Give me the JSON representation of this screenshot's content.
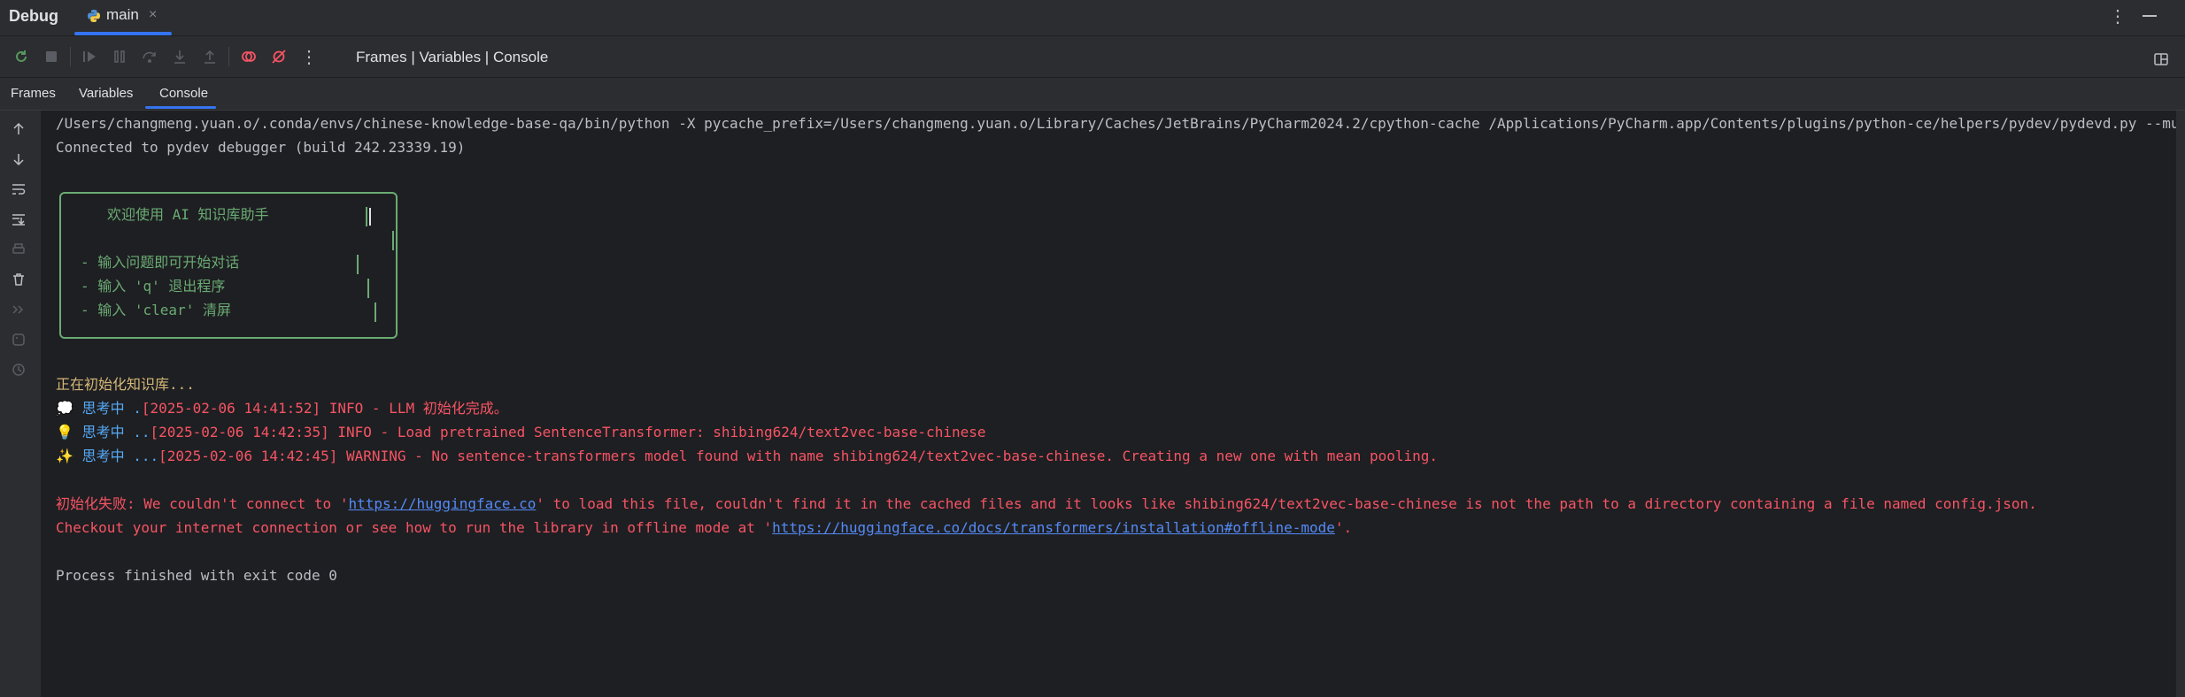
{
  "window": {
    "title": "Debug",
    "tab_label": "main",
    "close_glyph": "×",
    "more_glyph": "⋮"
  },
  "toolbar": {
    "layout_label": "Frames | Variables | Console",
    "more_glyph": "⋮",
    "icons": [
      "rerun-icon",
      "stop-icon",
      "resume-icon",
      "pause-icon",
      "step-over-icon",
      "step-into-icon",
      "step-out-icon",
      "view-breakpoints-icon",
      "mute-breakpoints-icon",
      "more-icon",
      "layout-icon"
    ]
  },
  "subtabs": {
    "frames": "Frames",
    "variables": "Variables",
    "console": "Console",
    "active": "Console"
  },
  "sidebar": {
    "icons": [
      "up-arrow-icon",
      "down-arrow-icon",
      "soft-wrap-icon",
      "scroll-to-end-icon",
      "print-icon",
      "trash-icon",
      "double-chevron-icon",
      "python-console-icon",
      "clock-icon"
    ]
  },
  "console": {
    "command_line": "/Users/changmeng.yuan.o/.conda/envs/chinese-knowledge-base-qa/bin/python -X pycache_prefix=/Users/changmeng.yuan.o/Library/Caches/JetBrains/PyCharm2024.2/cpython-cache /Applications/PyCharm.app/Contents/plugins/python-ce/helpers/pydev/pydevd.py --mu",
    "connected": "Connected to pydev debugger (build 242.23339.19)",
    "banner": {
      "welcome": "欢迎使用 AI 知识库助手",
      "item1": "- 输入问题即可开始对话",
      "item2": "- 输入 'q' 退出程序",
      "item3": "- 输入 'clear' 清屏"
    },
    "init_line": "正在初始化知识库...",
    "think1": {
      "emoji": "💭",
      "label": "思考中 .",
      "msg": "[2025-02-06 14:41:52] INFO - LLM 初始化完成。"
    },
    "think2": {
      "emoji": "💡",
      "label": "思考中 ..",
      "msg": "[2025-02-06 14:42:35] INFO - Load pretrained SentenceTransformer: shibing624/text2vec-base-chinese"
    },
    "think3": {
      "emoji": "✨",
      "label": "思考中 ...",
      "msg": "[2025-02-06 14:42:45] WARNING - No sentence-transformers model found with name shibing624/text2vec-base-chinese. Creating a new one with mean pooling."
    },
    "error1": {
      "prefix": "初始化失败: We couldn't connect to '",
      "link": "https://huggingface.co",
      "suffix": "' to load this file, couldn't find it in the cached files and it looks like shibing624/text2vec-base-chinese is not the path to a directory containing a file named config.json."
    },
    "error2": {
      "prefix": "Checkout your internet connection or see how to run the library in offline mode at '",
      "link": "https://huggingface.co/docs/transformers/installation#offline-mode",
      "suffix": "'."
    },
    "exit_line": "Process finished with exit code 0"
  },
  "colors": {
    "accent": "#3574f0",
    "green": "#6aab73",
    "red": "#f75464",
    "blue": "#56a8f5",
    "yellow": "#d5b778"
  }
}
